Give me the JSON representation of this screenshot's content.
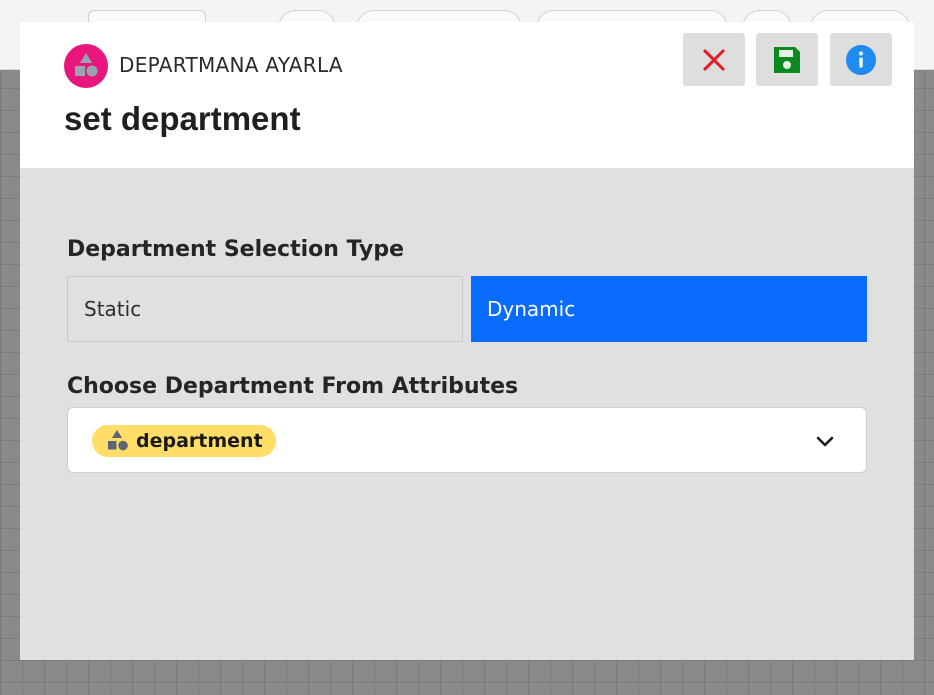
{
  "modal": {
    "subtitle": "DEPARTMANA AYARLA",
    "title": "set department",
    "header_icon": "shapes-icon",
    "accent_color": "#e8177d",
    "actions": {
      "close_icon": "close-icon",
      "save_icon": "save-icon",
      "info_icon": "info-icon"
    }
  },
  "form": {
    "selection_type_label": "Department Selection Type",
    "selection_type_options": [
      "Static",
      "Dynamic"
    ],
    "selected_option": "Dynamic",
    "selected_color": "#0a6cff",
    "attribute_label": "Choose Department From Attributes",
    "attribute_chip": {
      "label": "department",
      "icon": "shapes-icon",
      "color": "#ffdd66"
    },
    "dropdown_icon": "chevron-down-icon"
  }
}
